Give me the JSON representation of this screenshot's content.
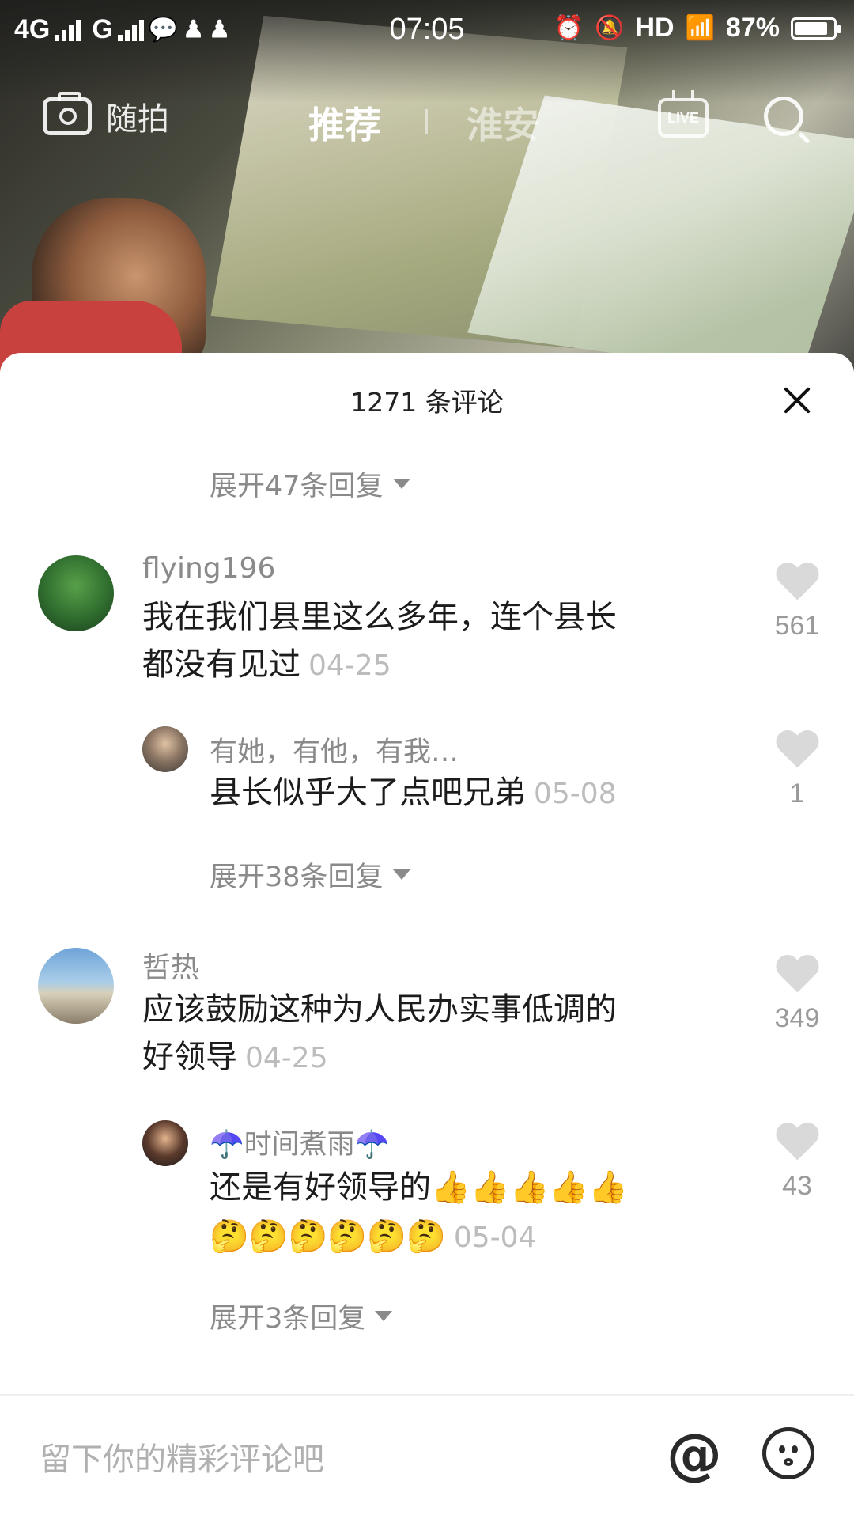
{
  "status_bar": {
    "network_left": "4G",
    "network_right": "G",
    "time": "07:05",
    "hd": "HD",
    "battery_text": "87%",
    "battery_level": 0.87
  },
  "top_nav": {
    "camera_label": "随拍",
    "tab_active": "推荐",
    "tab_inactive": "淮安"
  },
  "sheet": {
    "title": "1271 条评论",
    "expand_top": "展开47条回复"
  },
  "comments": [
    {
      "username": "flying196",
      "text_line1": "我在我们县里这么多年，连个县长",
      "text_line2": "都没有见过",
      "date": "04-25",
      "likes": "561",
      "reply": {
        "username": "有她，有他，有我…",
        "text": "县长似乎大了点吧兄弟",
        "date": "05-08",
        "likes": "1"
      },
      "expand": "展开38条回复"
    },
    {
      "username": "哲热",
      "text_line1": "应该鼓励这种为人民办实事低调的",
      "text_line2": "好领导",
      "date": "04-25",
      "likes": "349",
      "reply": {
        "username_prefix": "☂️",
        "username": "时间煮雨",
        "username_suffix": "☂️",
        "text": "还是有好领导的",
        "emoji_line1": "👍👍👍👍👍",
        "emoji_line2": "🤔🤔🤔🤔🤔🤔",
        "date": "05-04",
        "likes": "43"
      },
      "expand": "展开3条回复"
    }
  ],
  "input_bar": {
    "placeholder": "留下你的精彩评论吧"
  },
  "icons": {
    "camera": "camera-icon",
    "live": "live-icon",
    "search": "search-icon",
    "close": "close-icon",
    "heart": "heart-icon",
    "at": "at-icon",
    "emoji": "emoji-smiley-icon"
  }
}
